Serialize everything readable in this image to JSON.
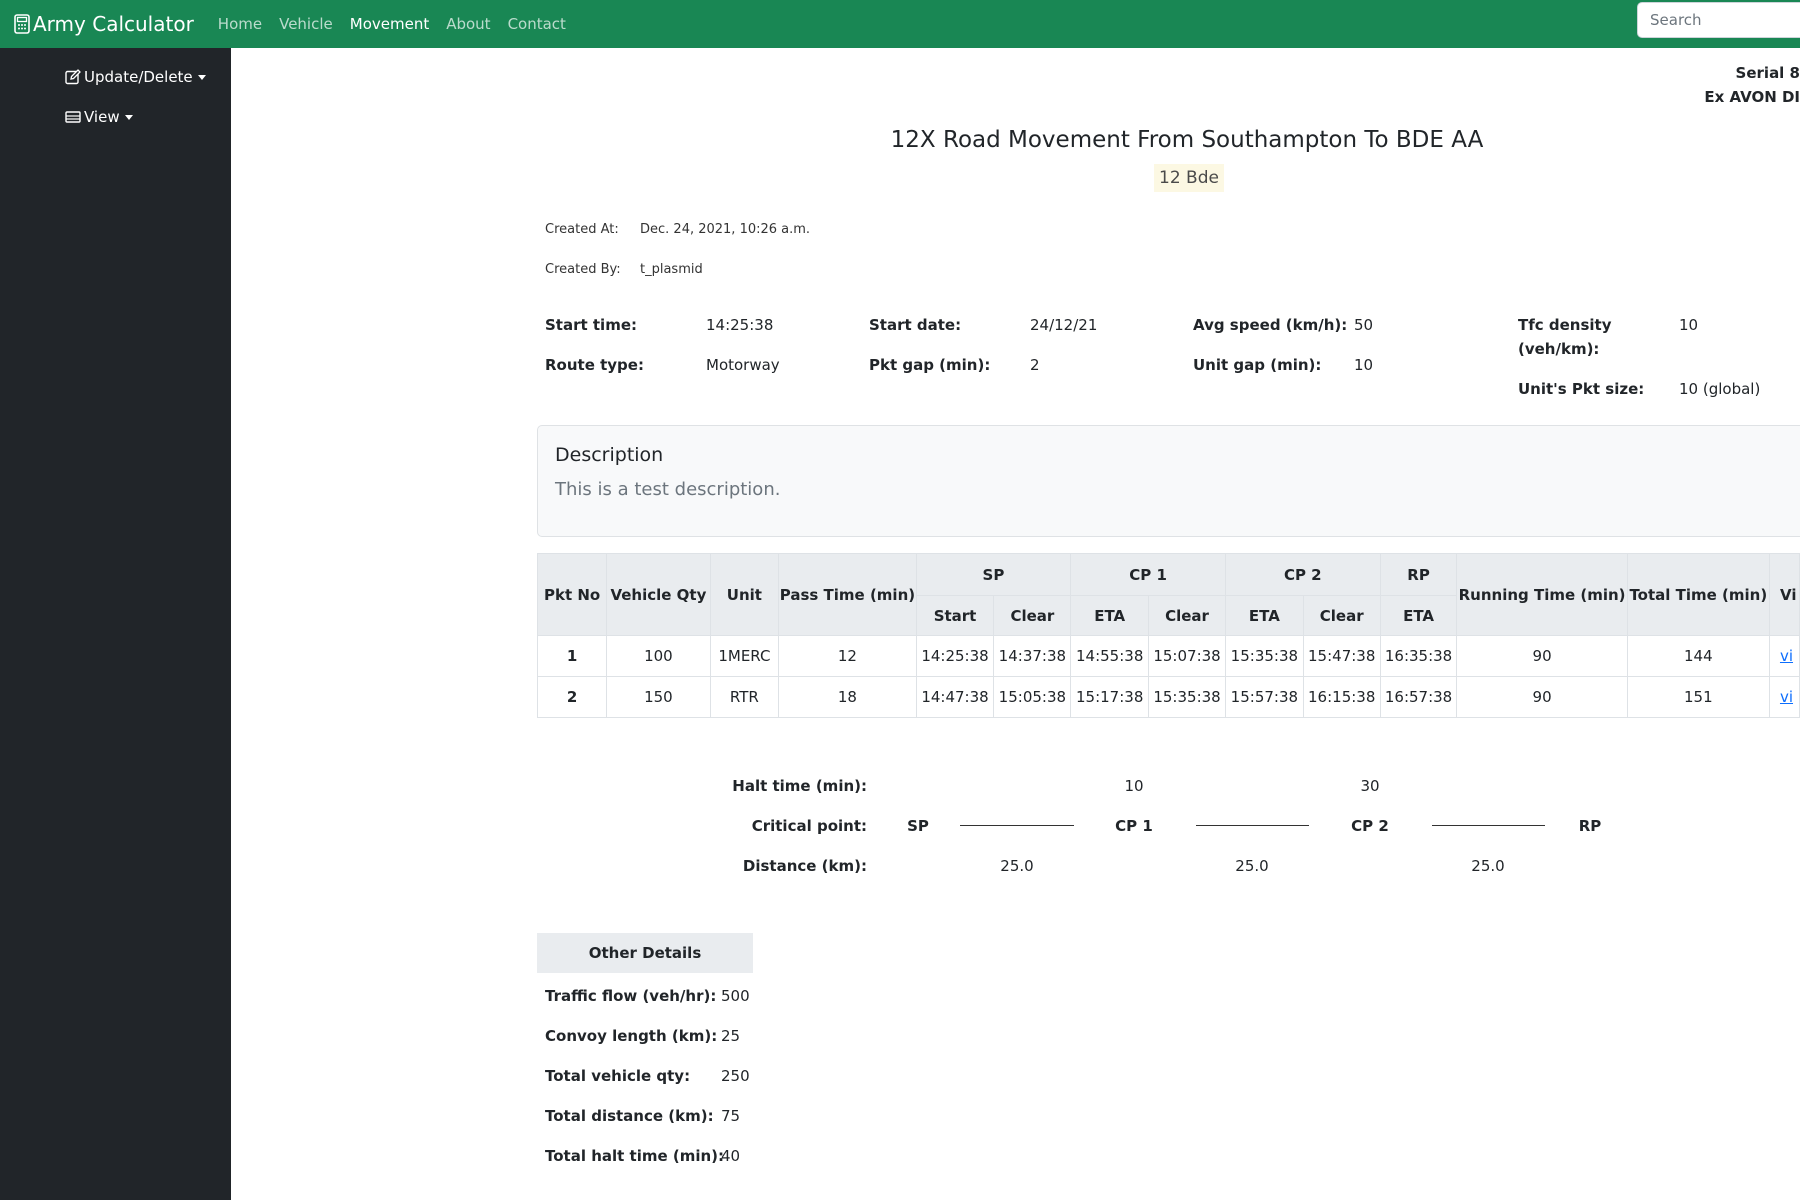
{
  "navbar": {
    "brand": "Army Calculator",
    "links": [
      "Home",
      "Vehicle",
      "Movement",
      "About",
      "Contact"
    ],
    "active_link": "Movement",
    "search_placeholder": "Search"
  },
  "sidebar": {
    "items": [
      {
        "label": "Update/Delete",
        "icon": "edit-icon"
      },
      {
        "label": "View",
        "icon": "view-icon"
      }
    ]
  },
  "header": {
    "serial": "Serial 8",
    "exercise": "Ex AVON DI",
    "title": "12X Road Movement From Southampton To BDE AA",
    "subtitle": "12 Bde"
  },
  "meta": {
    "created_at_label": "Created At:",
    "created_at": "Dec. 24, 2021, 10:26 a.m.",
    "created_by_label": "Created By:",
    "created_by": "t_plasmid"
  },
  "params": {
    "start_time_label": "Start time:",
    "start_time": "14:25:38",
    "start_date_label": "Start date:",
    "start_date": "24/12/21",
    "avg_speed_label": "Avg speed (km/h):",
    "avg_speed": "50",
    "tfc_density_label_1": "Tfc density",
    "tfc_density_label_2": "(veh/km):",
    "tfc_density": "10",
    "route_type_label": "Route type:",
    "route_type": "Motorway",
    "pkt_gap_label": "Pkt gap (min):",
    "pkt_gap": "2",
    "unit_gap_label": "Unit gap (min):",
    "unit_gap": "10",
    "pkt_size_label": "Unit's Pkt size:",
    "pkt_size": "10 (global)"
  },
  "description": {
    "heading": "Description",
    "text": "This is a test description."
  },
  "table": {
    "headers": {
      "pkt_no": "Pkt No",
      "vehicle_qty": "Vehicle Qty",
      "unit": "Unit",
      "pass_time": "Pass Time (min)",
      "sp": "SP",
      "cp1": "CP 1",
      "cp2": "CP 2",
      "rp": "RP",
      "running_time": "Running Time (min)",
      "total_time": "Total Time (min)",
      "view": "Vi",
      "start": "Start",
      "clear": "Clear",
      "eta": "ETA"
    },
    "rows": [
      {
        "pkt": "1",
        "qty": "100",
        "unit": "1MERC",
        "pass": "12",
        "sp_start": "14:25:38",
        "sp_clear": "14:37:38",
        "cp1_eta": "14:55:38",
        "cp1_clear": "15:07:38",
        "cp2_eta": "15:35:38",
        "cp2_clear": "15:47:38",
        "rp_eta": "16:35:38",
        "running": "90",
        "total": "144",
        "link": "vi"
      },
      {
        "pkt": "2",
        "qty": "150",
        "unit": "RTR",
        "pass": "18",
        "sp_start": "14:47:38",
        "sp_clear": "15:05:38",
        "cp1_eta": "15:17:38",
        "cp1_clear": "15:35:38",
        "cp2_eta": "15:57:38",
        "cp2_clear": "16:15:38",
        "rp_eta": "16:57:38",
        "running": "90",
        "total": "151",
        "link": "vi"
      }
    ]
  },
  "route": {
    "halt_label": "Halt time (min):",
    "halt_cp1": "10",
    "halt_cp2": "30",
    "critical_label": "Critical point:",
    "points": [
      "SP",
      "CP 1",
      "CP 2",
      "RP"
    ],
    "distance_label": "Distance (km):",
    "distances": [
      "25.0",
      "25.0",
      "25.0"
    ]
  },
  "other": {
    "heading": "Other Details",
    "items": [
      {
        "label": "Traffic flow (veh/hr):",
        "value": "500"
      },
      {
        "label": "Convoy length (km):",
        "value": "25"
      },
      {
        "label": "Total vehicle qty:",
        "value": "250"
      },
      {
        "label": "Total distance (km):",
        "value": "75"
      },
      {
        "label": "Total halt time (min):",
        "value": "40"
      }
    ]
  },
  "colors": {
    "navbar": "#198754",
    "sidebar": "#212529",
    "link": "#0d6efd",
    "highlight": "#fcf8e3"
  }
}
